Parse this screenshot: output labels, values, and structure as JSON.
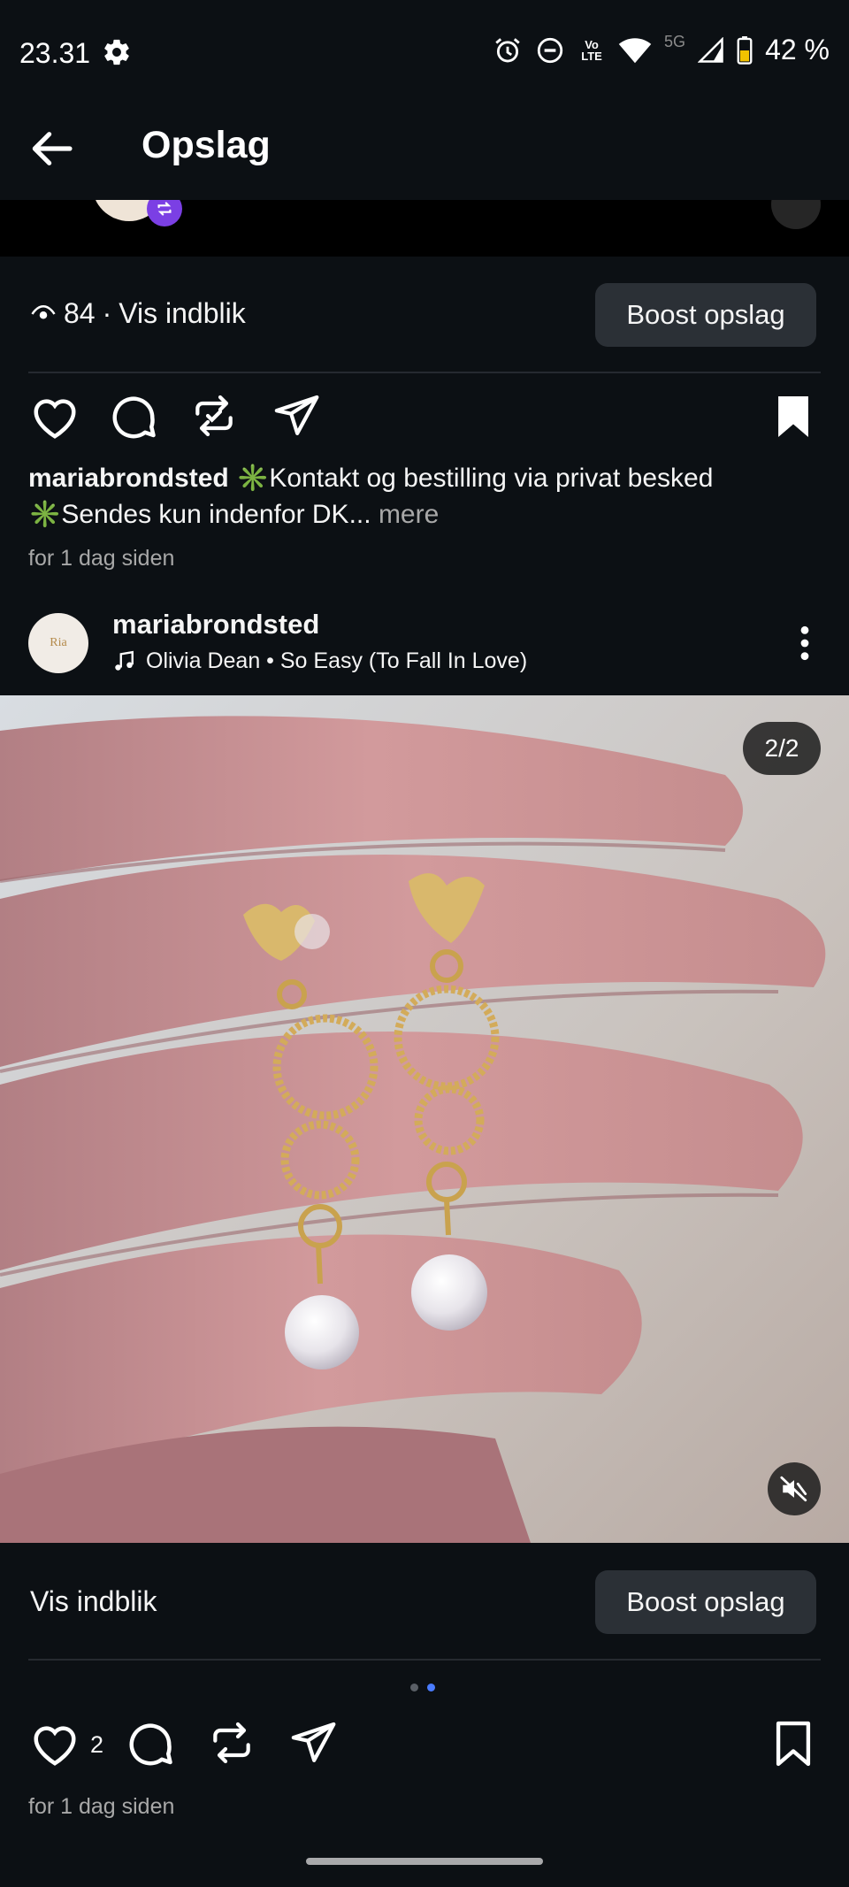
{
  "status_bar": {
    "time": "23.31",
    "battery": "42 %",
    "network_label": "5G",
    "volte_label": "Vo LTE"
  },
  "app_bar": {
    "title": "Opslag"
  },
  "previous_post": {
    "views": "84",
    "insights_label": "Vis indblik",
    "views_separator": "·",
    "boost_label": "Boost opslag",
    "caption_user": "mariabrondsted",
    "caption_line1": "✳️Kontakt og bestilling via privat besked",
    "caption_line2": "✳️Sendes kun indenfor DK",
    "caption_ellipsis": "...",
    "caption_more": "mere",
    "timestamp": "for 1 dag siden"
  },
  "post": {
    "username": "mariabrondsted",
    "avatar_text": "Ria",
    "music": "Olivia Dean • So Easy (To Fall In Love)",
    "media_counter": "2/2",
    "insights_label": "Vis indblik",
    "boost_label": "Boost opslag",
    "like_count": "2",
    "timestamp": "for 1 dag siden",
    "carousel": {
      "total": 2,
      "active_index": 1
    }
  },
  "colors": {
    "background": "#0c1014",
    "button": "#2b3036",
    "accent_dot": "#4a7cff",
    "repost_badge": "#7b3fe4"
  },
  "icons": [
    "gear-icon",
    "alarm-icon",
    "dnd-icon",
    "wifi-icon",
    "signal-icon",
    "battery-icon",
    "back-arrow-icon",
    "eye-icon",
    "heart-icon",
    "comment-icon",
    "repost-icon",
    "share-icon",
    "bookmark-icon",
    "music-icon",
    "more-icon",
    "mute-icon"
  ]
}
